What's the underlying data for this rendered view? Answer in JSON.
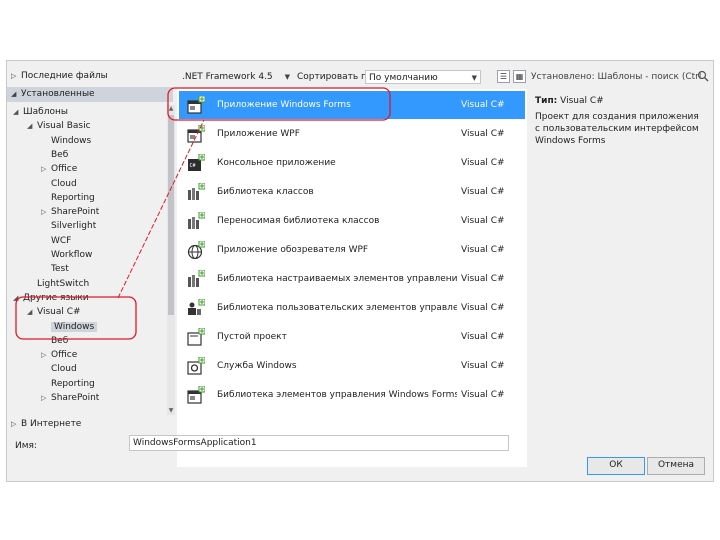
{
  "left_panel": {
    "recent": "Последние файлы",
    "installed": "Установленные",
    "online": "В Интернете",
    "tree": [
      {
        "label": "Шаблоны",
        "indent": 0,
        "tri": "◢"
      },
      {
        "label": "Visual Basic",
        "indent": 1,
        "tri": "◢"
      },
      {
        "label": "Windows",
        "indent": 2,
        "tri": ""
      },
      {
        "label": "Веб",
        "indent": 2,
        "tri": ""
      },
      {
        "label": "Office",
        "indent": 2,
        "tri": "▷"
      },
      {
        "label": "Cloud",
        "indent": 2,
        "tri": ""
      },
      {
        "label": "Reporting",
        "indent": 2,
        "tri": ""
      },
      {
        "label": "SharePoint",
        "indent": 2,
        "tri": "▷"
      },
      {
        "label": "Silverlight",
        "indent": 2,
        "tri": ""
      },
      {
        "label": "WCF",
        "indent": 2,
        "tri": ""
      },
      {
        "label": "Workflow",
        "indent": 2,
        "tri": ""
      },
      {
        "label": "Test",
        "indent": 2,
        "tri": ""
      },
      {
        "label": "LightSwitch",
        "indent": 1,
        "tri": ""
      },
      {
        "label": "Другие языки",
        "indent": 0,
        "tri": "◢"
      },
      {
        "label": "Visual C#",
        "indent": 1,
        "tri": "◢"
      },
      {
        "label": "Windows",
        "indent": 2,
        "tri": "",
        "selected": true
      },
      {
        "label": "Веб",
        "indent": 2,
        "tri": ""
      },
      {
        "label": "Office",
        "indent": 2,
        "tri": "▷"
      },
      {
        "label": "Cloud",
        "indent": 2,
        "tri": ""
      },
      {
        "label": "Reporting",
        "indent": 2,
        "tri": ""
      },
      {
        "label": "SharePoint",
        "indent": 2,
        "tri": "▷"
      }
    ]
  },
  "toolbar": {
    "framework": ".NET Framework 4.5",
    "sort_label": "Сортировать по:",
    "sort_value": "По умолчанию"
  },
  "search": {
    "placeholder": "Установлено: Шаблоны - поиск (Ctrl"
  },
  "templates": [
    {
      "name": "Приложение Windows Forms",
      "lang": "Visual C#",
      "icon": "windows-forms-icon",
      "selected": true
    },
    {
      "name": "Приложение WPF",
      "lang": "Visual C#",
      "icon": "wpf-app-icon"
    },
    {
      "name": "Консольное приложение",
      "lang": "Visual C#",
      "icon": "console-app-icon"
    },
    {
      "name": "Библиотека классов",
      "lang": "Visual C#",
      "icon": "class-library-icon"
    },
    {
      "name": "Переносимая библиотека классов",
      "lang": "Visual C#",
      "icon": "portable-library-icon"
    },
    {
      "name": "Приложение обозревателя WPF",
      "lang": "Visual C#",
      "icon": "wpf-browser-icon"
    },
    {
      "name": "Библиотека настраиваемых элементов управления WPF",
      "lang": "Visual C#",
      "icon": "wpf-custom-control-icon"
    },
    {
      "name": "Библиотека пользовательских элементов управления W...",
      "lang": "Visual C#",
      "icon": "wpf-user-control-icon"
    },
    {
      "name": "Пустой проект",
      "lang": "Visual C#",
      "icon": "empty-project-icon"
    },
    {
      "name": "Служба Windows",
      "lang": "Visual C#",
      "icon": "windows-service-icon"
    },
    {
      "name": "Библиотека элементов управления Windows Forms",
      "lang": "Visual C#",
      "icon": "winforms-control-library-icon"
    }
  ],
  "details": {
    "type_label": "Тип:",
    "type_value": "Visual C#",
    "description": "Проект для создания приложения с пользовательским интерфейсом Windows Forms"
  },
  "bottom": {
    "name_label": "Имя:",
    "name_value": "WindowsFormsApplication1",
    "ok": "ОК",
    "cancel": "Отмена"
  },
  "colors": {
    "selection": "#3399ff",
    "annotation": "#e0182d"
  }
}
